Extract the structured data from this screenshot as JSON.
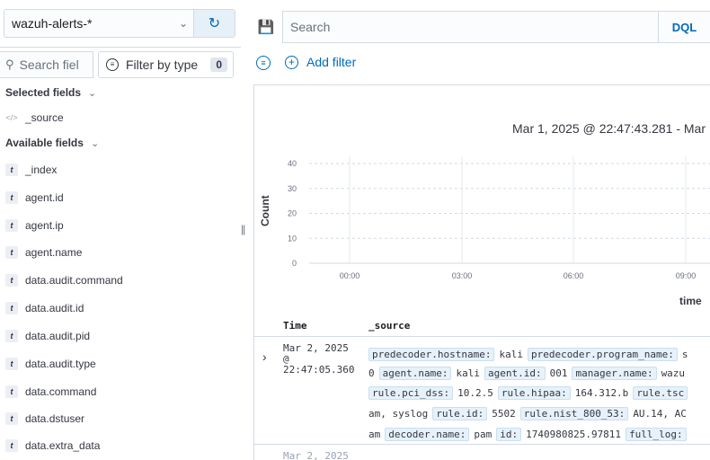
{
  "sidebar": {
    "index_pattern": "wazuh-alerts-*",
    "field_search_placeholder": "Search fiel",
    "filter_by_type_label": "Filter by type",
    "filter_count": "0",
    "selected_fields_title": "Selected fields",
    "selected_fields": [
      {
        "type": "source",
        "name": "_source"
      }
    ],
    "available_fields_title": "Available fields",
    "available_fields": [
      {
        "type": "t",
        "name": "_index"
      },
      {
        "type": "t",
        "name": "agent.id"
      },
      {
        "type": "t",
        "name": "agent.ip"
      },
      {
        "type": "t",
        "name": "agent.name"
      },
      {
        "type": "t",
        "name": "data.audit.command"
      },
      {
        "type": "t",
        "name": "data.audit.id"
      },
      {
        "type": "t",
        "name": "data.audit.pid"
      },
      {
        "type": "t",
        "name": "data.audit.type"
      },
      {
        "type": "t",
        "name": "data.command"
      },
      {
        "type": "t",
        "name": "data.dstuser"
      },
      {
        "type": "t",
        "name": "data.extra_data"
      }
    ]
  },
  "query_bar": {
    "placeholder": "Search",
    "language": "DQL",
    "add_filter_label": "Add filter"
  },
  "main": {
    "time_range": "Mar 1, 2025 @ 22:47:43.281 - Mar",
    "y_axis_label": "Count",
    "x_axis_label": "time",
    "table_headers": {
      "time": "Time",
      "source": "_source"
    },
    "rows": [
      {
        "time": "Mar 2, 2025\n@\n22:47:05.360",
        "source_lines": [
          [
            {
              "k": "predecoder.hostname:"
            },
            {
              "v": "kali"
            },
            {
              "k": "predecoder.program_name:"
            },
            {
              "v": "s"
            }
          ],
          [
            {
              "v": "0"
            },
            {
              "k": "agent.name:"
            },
            {
              "v": "kali"
            },
            {
              "k": "agent.id:"
            },
            {
              "v": "001"
            },
            {
              "k": "manager.name:"
            },
            {
              "v": "wazu"
            }
          ],
          [
            {
              "k": "rule.pci_dss:"
            },
            {
              "v": "10.2.5"
            },
            {
              "k": "rule.hipaa:"
            },
            {
              "v": "164.312.b"
            },
            {
              "k": "rule.tsc"
            }
          ],
          [
            {
              "v": "am, syslog"
            },
            {
              "k": "rule.id:"
            },
            {
              "v": "5502"
            },
            {
              "k": "rule.nist_800_53:"
            },
            {
              "v": "AU.14, AC"
            }
          ],
          [
            {
              "v": "am"
            },
            {
              "k": "decoder.name:"
            },
            {
              "v": "pam"
            },
            {
              "k": "id:"
            },
            {
              "v": "1740980825.97811"
            },
            {
              "k": "full_log:"
            }
          ]
        ]
      }
    ],
    "partial_row_time": "Mar 2, 2025"
  },
  "chart_data": {
    "type": "bar",
    "title": "",
    "ylabel": "Count",
    "xlabel": "time",
    "ylim": [
      0,
      40
    ],
    "y_ticks": [
      "40",
      "30",
      "20",
      "10",
      "0"
    ],
    "x_ticks": [
      "00:00",
      "03:00",
      "06:00",
      "09:00"
    ],
    "grid": true,
    "series": [
      {
        "values": []
      }
    ]
  },
  "colors": {
    "accent": "#006bb8",
    "border": "#d3dae6",
    "text": "#343741"
  }
}
